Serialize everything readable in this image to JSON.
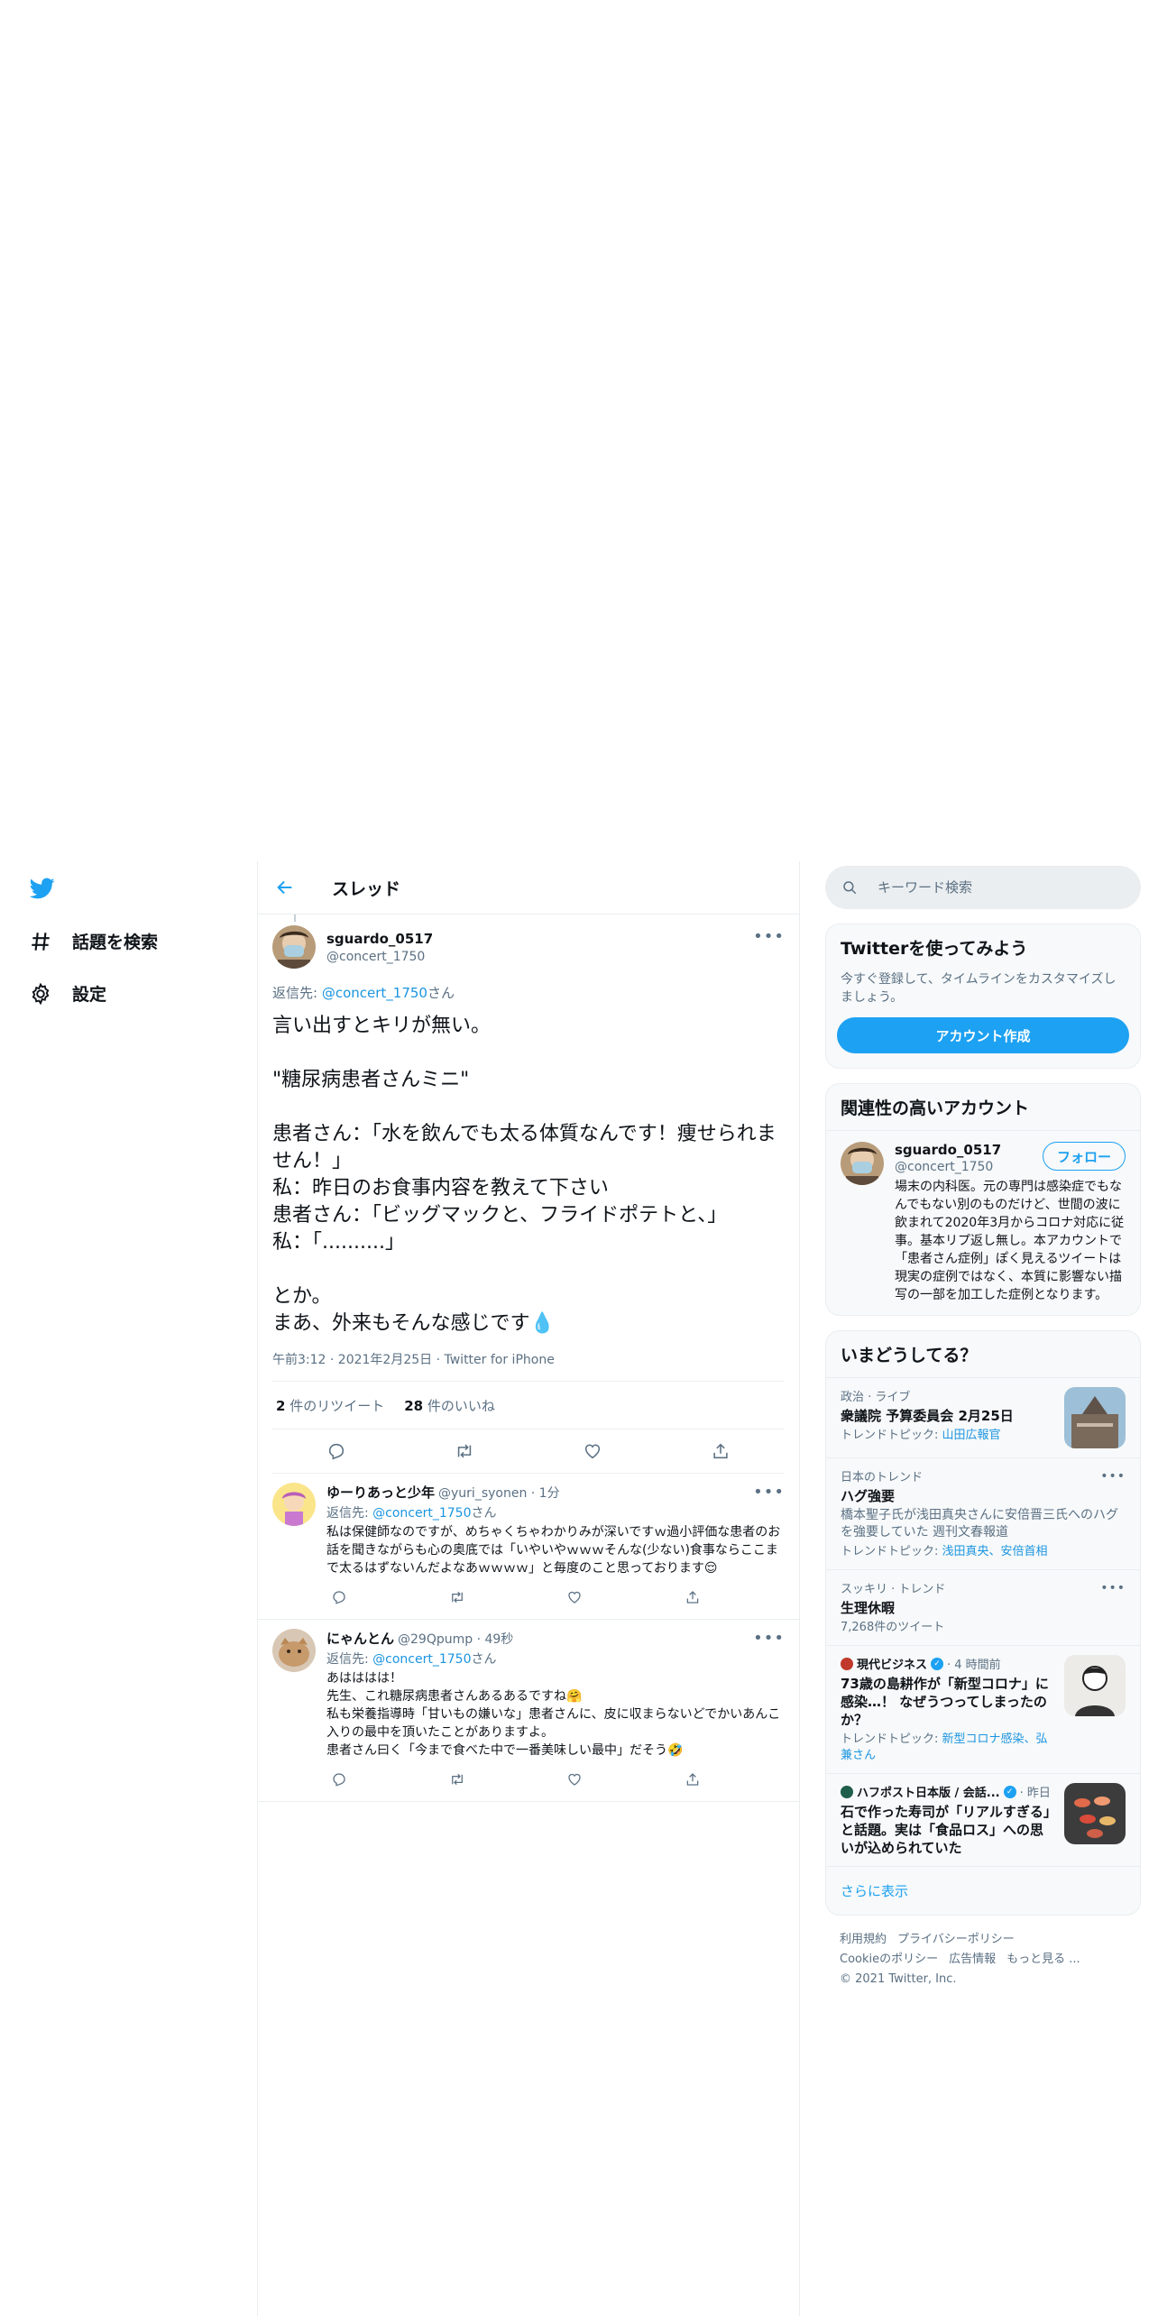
{
  "nav": {
    "explore_label": "話題を検索",
    "settings_label": "設定"
  },
  "main": {
    "title": "スレッド",
    "focus_tweet": {
      "name": "sguardo_0517",
      "handle": "@concert_1750",
      "reply_prefix": "返信先: ",
      "reply_handle": "@concert_1750",
      "reply_suffix": "さん",
      "text": "言い出すとキリが無い。\n\n\"糖尿病患者さんミニ\"\n\n患者さん：「水を飲んでも太る体質なんです！痩せられません！」\n私：昨日のお食事内容を教えて下さい\n患者さん：「ビッグマックと、フライドポテトと、」\n私：「..........」\n\nとか。\nまあ、外来もそんな感じです💧",
      "meta": "午前3:12 · 2021年2月25日 · Twitter for iPhone",
      "retweets_count": "2",
      "retweets_label": " 件のリツイート",
      "likes_count": "28",
      "likes_label": " 件のいいね"
    },
    "replies": [
      {
        "name": "ゆーりあっと少年",
        "handle": "@yuri_syonen · 1分",
        "reply_prefix": "返信先: ",
        "reply_handle": "@concert_1750",
        "reply_suffix": "さん",
        "text": "私は保健師なのですが、めちゃくちゃわかりみが深いですｗ過小評価な患者のお話を聞きながらも心の奥底では「いやいやｗｗｗそんな(少ない)食事ならここまで太るはずないんだよなあｗｗｗｗ」と毎度のこと思っております😌"
      },
      {
        "name": "にゃんとん",
        "handle": "@29Qpump · 49秒",
        "reply_prefix": "返信先: ",
        "reply_handle": "@concert_1750",
        "reply_suffix": "さん",
        "text": "あはははは！\n先生、これ糖尿病患者さんあるあるですね🤗\n私も栄養指導時「甘いもの嫌いな」患者さんに、皮に収まらないどでかいあんこ入りの最中を頂いたことがありますよ。\n患者さん曰く「今まで食べた中で一番美味しい最中」だそう🤣"
      }
    ]
  },
  "sidebar": {
    "search_placeholder": "キーワード検索",
    "signup": {
      "title": "Twitterを使ってみよう",
      "desc": "今すぐ登録して、タイムラインをカスタマイズしましょう。",
      "button": "アカウント作成"
    },
    "related": {
      "title": "関連性の高いアカウント",
      "name": "sguardo_0517",
      "handle": "@concert_1750",
      "follow": "フォロー",
      "bio": "場末の内科医。元の専門は感染症でもなんでもない別のものだけど、世間の波に飲まれて2020年3月からコロナ対応に従事。基本リプ返し無し。本アカウントで「患者さん症例」ぽく見えるツイートは現実の症例ではなく、本質に影響ない描写の一部を加工した症例となります。"
    },
    "trends": {
      "title": "いまどうしてる？",
      "items": [
        {
          "context": "政治 · ライブ",
          "name": "衆議院 予算委員会 2月25日",
          "topic_label": "トレンドトピック: ",
          "topic": "山田広報官"
        },
        {
          "context": "日本のトレンド",
          "name": "ハグ強要",
          "desc": "橋本聖子氏が浅田真央さんに安倍晋三氏へのハグを強要していた 週刊文春報道",
          "topic_label": "トレンドトピック: ",
          "topic": "浅田真央、安倍首相"
        },
        {
          "context": "スッキリ · トレンド",
          "name": "生理休暇",
          "count": "7,268件のツイート"
        },
        {
          "source": "現代ビジネス",
          "time": " · 4 時間前",
          "name": "73歳の島耕作が「新型コロナ」に感染…！ なぜうつってしまったのか？",
          "topic_label": "トレンドトピック: ",
          "topic": "新型コロナ感染、弘兼さん"
        },
        {
          "source": "ハフポスト日本版 / 会話...",
          "time": " · 昨日",
          "name": "石で作った寿司が「リアルすぎる」と話題。実は「食品ロス」への思いが込められていた"
        }
      ],
      "show_more": "さらに表示"
    },
    "footer": {
      "terms": "利用規約",
      "privacy": "プライバシーポリシー",
      "cookie": "Cookieのポリシー",
      "ads": "広告情報",
      "more": "もっと見る ...",
      "copyright": "© 2021 Twitter, Inc."
    }
  },
  "colors": {
    "accent": "#1da1f2",
    "link": "#1b95e0",
    "muted": "#5b7083",
    "border": "#ebeef0"
  },
  "icons": [
    "twitter-logo-icon",
    "hashtag-icon",
    "gear-icon",
    "back-arrow-icon",
    "more-icon",
    "reply-icon",
    "retweet-icon",
    "like-icon",
    "share-icon",
    "search-icon",
    "verified-icon"
  ]
}
